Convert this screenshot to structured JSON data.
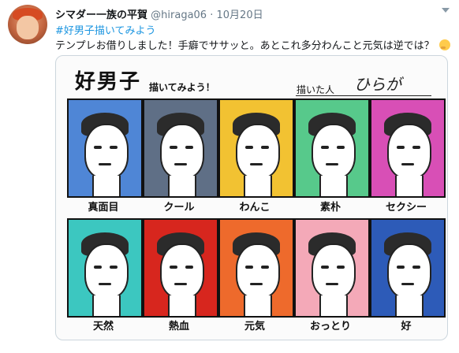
{
  "tweet": {
    "display_name": "シマダー一族の平賀",
    "handle": "@hiraga06",
    "separator": "·",
    "date": "10月20日",
    "hashtag": "#好男子描いてみよう",
    "text": "テンプレお借りしました！手癖でササッと。あとこれ多分わんこと元気は逆では？",
    "emoji": "thinking-face-icon"
  },
  "card": {
    "title": "好男子",
    "subtitle": "描いてみよう！",
    "artist_label": "描いた人",
    "artist_signature": "ひらが",
    "panels": [
      {
        "label": "真面目",
        "color": "#4f86d6"
      },
      {
        "label": "クール",
        "color": "#5f6f86"
      },
      {
        "label": "わんこ",
        "color": "#f2c232"
      },
      {
        "label": "素朴",
        "color": "#57c98b"
      },
      {
        "label": "セクシー",
        "color": "#d84fb6"
      },
      {
        "label": "天然",
        "color": "#3cc7c0"
      },
      {
        "label": "熱血",
        "color": "#d7261e"
      },
      {
        "label": "元気",
        "color": "#ee6a2c"
      },
      {
        "label": "おっとり",
        "color": "#f4a9b8"
      },
      {
        "label": "好",
        "color": "#2d5bb8"
      }
    ]
  }
}
